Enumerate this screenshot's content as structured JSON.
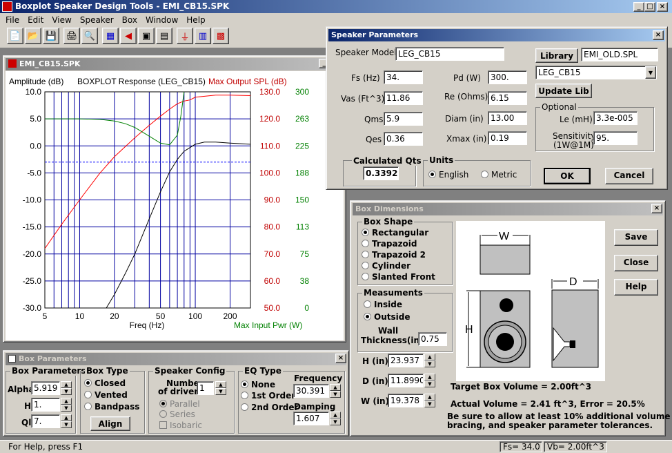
{
  "app": {
    "title": "Boxplot Speaker Design Tools - EMI_CB15.SPK",
    "status": "For Help, press F1",
    "fs": "Fs= 34.0",
    "vb": "Vb=  2.00ft^3"
  },
  "menu": [
    "File",
    "Edit",
    "View",
    "Speaker",
    "Box",
    "Window",
    "Help"
  ],
  "toolbar": [
    "new-icon",
    "open-icon",
    "save-icon",
    "print-icon",
    "zoom-icon",
    "driver-icon",
    "speaker-icon",
    "box-icon",
    "graph-icon",
    "filter-icon",
    "crossover-icon",
    "amp-icon"
  ],
  "graph": {
    "title": "EMI_CB15.SPK",
    "left_label": "Amplitude (dB)",
    "center_label": "BOXPLOT Response (LEG_CB15)",
    "right_label": "Max Output SPL (dB)",
    "x_label": "Freq (Hz)",
    "x2_label": "Max Input Pwr (W)",
    "y_ticks": [
      "10.0",
      "5.0",
      "0.0",
      "-5.0",
      "-10.0",
      "-15.0",
      "-20.0",
      "-25.0",
      "-30.0"
    ],
    "spl_ticks": [
      "130.0",
      "120.0",
      "110.0",
      "100.0",
      "90.0",
      "80.0",
      "70.0",
      "60.0",
      "50.0"
    ],
    "pwr_ticks": [
      "300",
      "263",
      "225",
      "188",
      "150",
      "113",
      "75",
      "38",
      "0"
    ],
    "x_ticks": [
      "5",
      "10",
      "20",
      "50",
      "100",
      "200"
    ]
  },
  "chart_data": {
    "type": "line",
    "xlabel": "Freq (Hz)",
    "ylabel": "Amplitude (dB)",
    "x_scale": "log",
    "xlim": [
      5,
      300
    ],
    "ylim": [
      -30,
      10
    ],
    "series": [
      {
        "color": "#000000",
        "x": [
          17,
          20,
          25,
          30,
          40,
          50,
          60,
          70,
          80,
          100,
          120,
          150,
          200,
          300
        ],
        "y": [
          -30,
          -27.5,
          -23.5,
          -20,
          -13.5,
          -8.5,
          -4.8,
          -2.5,
          -1,
          0.3,
          0.7,
          0.7,
          0.5,
          0.3
        ]
      },
      {
        "color": "#ff0000",
        "x": [
          5,
          7,
          10,
          15,
          20,
          30,
          40,
          50,
          60,
          70,
          80,
          90,
          100,
          150,
          200,
          300
        ],
        "y": [
          -19,
          -14.5,
          -10,
          -5,
          -2,
          1.5,
          3.8,
          5.5,
          6.8,
          7.8,
          8.3,
          8.5,
          9,
          9.4,
          9.4,
          9.3
        ]
      },
      {
        "color": "#008000",
        "x": [
          5,
          10,
          15,
          20,
          25,
          30,
          40,
          50,
          60,
          70,
          75,
          80
        ],
        "y": [
          5,
          5,
          4.9,
          4.6,
          4.1,
          3.4,
          1.8,
          0.5,
          0.2,
          2,
          5.5,
          10
        ]
      },
      {
        "color": "#0000ff",
        "x": [
          5,
          300
        ],
        "y": [
          -3,
          -3
        ]
      }
    ]
  },
  "speaker": {
    "title": "Speaker Parameters",
    "model_label": "Speaker Model",
    "model": "LEG_CB15",
    "library_btn": "Library",
    "library_file": "EMI_OLD.SPL",
    "library_sel": "LEG_CB15",
    "update_btn": "Update Lib",
    "fs_label": "Fs (Hz)",
    "fs": "34.",
    "vas_label": "Vas (Ft^3)",
    "vas": "11.86",
    "qms_label": "Qms",
    "qms": "5.9",
    "qes_label": "Qes",
    "qes": "0.36",
    "pd_label": "Pd (W)",
    "pd": "300.",
    "re_label": "Re (Ohms)",
    "re": "6.15",
    "diam_label": "Diam  (in)",
    "diam": "13.00",
    "xmax_label": "Xmax (in)",
    "xmax": "0.19",
    "optional": "Optional",
    "le_label": "Le (mH)",
    "le": "3.3e-005",
    "sens_label": "Sensitivity",
    "sens_label2": "(1W@1M)",
    "sens": "95.",
    "qts_label": "Calculated Qts",
    "qts": "0.33929",
    "units": "Units",
    "english": "English",
    "metric": "Metric",
    "ok": "OK",
    "cancel": "Cancel"
  },
  "boxdim": {
    "title": "Box Dimensions",
    "shape": "Box Shape",
    "shapes": [
      "Rectangular",
      "Trapazoid",
      "Trapazoid 2",
      "Cylinder",
      "Slanted Front"
    ],
    "meas": "Measuments",
    "inside": "Inside",
    "outside": "Outside",
    "wall_label": "Wall",
    "wall_label2": "Thickness(in)",
    "wall": "0.75",
    "h_label": "H (in)",
    "h": "23.937",
    "d_label": "D (in)",
    "d": "11.8990",
    "w_label": "W (in)",
    "w": "19.378",
    "W": "W",
    "D": "D",
    "H": "H",
    "save": "Save",
    "close": "Close",
    "help": "Help",
    "target": "Target Box Volume =       2.00ft^3",
    "actual": "Actual Volume =     2.41 ft^3, Error =    20.5%",
    "note1": "Be sure to allow at least 10% additional volume for",
    "note2": "bracing, and speaker parameter tolerances."
  },
  "boxparam": {
    "title": "Box Parameters",
    "group": "Box Parameters",
    "alpha_label": "Alpha",
    "alpha": "5.919",
    "h_label": "H",
    "h": "1.",
    "ql_label": "Ql",
    "ql": "7.",
    "type": "Box Type",
    "closed": "Closed",
    "vented": "Vented",
    "bandpass": "Bandpass",
    "align": "Align",
    "config": "Speaker Config",
    "ndrv_label": "Number",
    "ndrv_label2": "of drivers",
    "ndrv": "1",
    "parallel": "Parallel",
    "series": "Series",
    "isobaric": "Isobaric",
    "eq": "EQ Type",
    "none": "None",
    "first": "1st Order",
    "second": "2nd Order",
    "freq_label": "Frequency",
    "freq": "30.391",
    "damp_label": "Damping",
    "damp": "1.607"
  }
}
